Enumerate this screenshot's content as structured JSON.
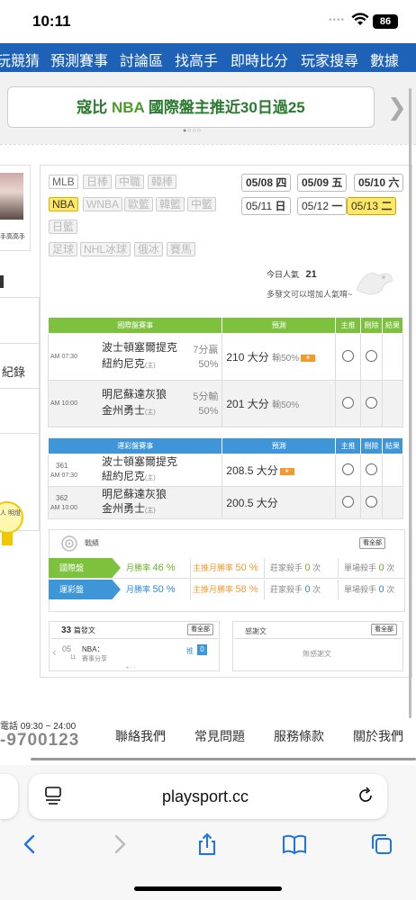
{
  "status": {
    "time": "10:11",
    "battery": "86"
  },
  "nav": {
    "items": [
      "玩競猜",
      "預測賽事",
      "討論區",
      "找高手",
      "即時比分",
      "玩家搜尋",
      "數據"
    ]
  },
  "banner": {
    "prefix": "寇比",
    "league": "NBA",
    "suffix": "國際盤主推近30日過25"
  },
  "sidebar": {
    "avatar_label": "手高高手",
    "record_label": "紀錄",
    "bulb_text": "人 明燈"
  },
  "sports": [
    "MLB",
    "日棒",
    "中職",
    "韓棒",
    "NBA",
    "WNBA",
    "歐籃",
    "韓籃",
    "中籃",
    "日籃",
    "足球",
    "NHL冰球",
    "俄冰",
    "賽馬"
  ],
  "dates": [
    {
      "d": "05/08",
      "w": "四"
    },
    {
      "d": "05/09",
      "w": "五"
    },
    {
      "d": "05/10",
      "w": "六"
    },
    {
      "d": "05/11",
      "w": "日"
    },
    {
      "d": "05/12",
      "w": "一"
    },
    {
      "d": "05/13",
      "w": "二"
    }
  ],
  "popularity": {
    "label": "今日人氣",
    "value": "21",
    "note": "多發文可以增加人氣唷~"
  },
  "intl_table": {
    "headers": [
      "國際盤賽事",
      "預測",
      "主推",
      "刪除",
      "結果"
    ],
    "games": [
      {
        "time": "AM 07:30",
        "away": "波士頓塞爾提克",
        "home": "紐約尼克",
        "home_mark": "(主)",
        "hc1": "7分贏",
        "hc2": "50%",
        "pred": "210 大分",
        "loss": "輸50%",
        "hot": true
      },
      {
        "time": "AM 10:00",
        "away": "明尼蘇達灰狼",
        "home": "金州勇士",
        "home_mark": "(主)",
        "hc1": "5分輸",
        "hc2": "50%",
        "pred": "201 大分",
        "loss": "輸50%",
        "hot": false
      }
    ]
  },
  "lottery_table": {
    "headers": [
      "運彩盤賽事",
      "預測",
      "主推",
      "刪除",
      "結果"
    ],
    "games": [
      {
        "no": "361",
        "time": "AM 07:30",
        "away": "波士頓塞爾提克",
        "home": "紐約尼克",
        "home_mark": "(主)",
        "pred": "208.5 大分",
        "hot": true
      },
      {
        "no": "362",
        "time": "AM 10:00",
        "away": "明尼蘇達灰狼",
        "home": "金州勇士",
        "home_mark": "(主)",
        "pred": "200.5 大分",
        "hot": false
      }
    ]
  },
  "stats": {
    "title": "戰績",
    "view_all": "看全部",
    "rows": [
      {
        "tag": "國際盤",
        "win_label": "月勝率",
        "win": "46 %",
        "main_label": "主推月勝率",
        "main": "50 %",
        "kill_label": "莊家殺手",
        "kill": "0",
        "kill_unit": "次",
        "single_label": "單場殺手",
        "single": "0",
        "single_unit": "次"
      },
      {
        "tag": "運彩盤",
        "win_label": "月勝率",
        "win": "50 %",
        "main_label": "主推月勝率",
        "main": "58 %",
        "kill_label": "莊家殺手",
        "kill": "0",
        "kill_unit": "次",
        "single_label": "單場殺手",
        "single": "0",
        "single_unit": "次"
      }
    ]
  },
  "posts": {
    "count": "33",
    "label": "篇發文",
    "view_all": "看全部",
    "item_date_m": "05",
    "item_date_d": "11",
    "item_title": "NBA：",
    "item_sub": "賽事分享",
    "push_label": "推",
    "push_count": "0"
  },
  "thanks": {
    "label": "感謝文",
    "view_all": "看全部",
    "empty": "無感謝文"
  },
  "footer": {
    "phone_label": "電話 09:30 ~ 24:00",
    "phone": "-9700123",
    "links": [
      "聯絡我們",
      "常見問題",
      "服務條款",
      "關於我們"
    ]
  },
  "browser": {
    "url": "playsport.cc"
  }
}
